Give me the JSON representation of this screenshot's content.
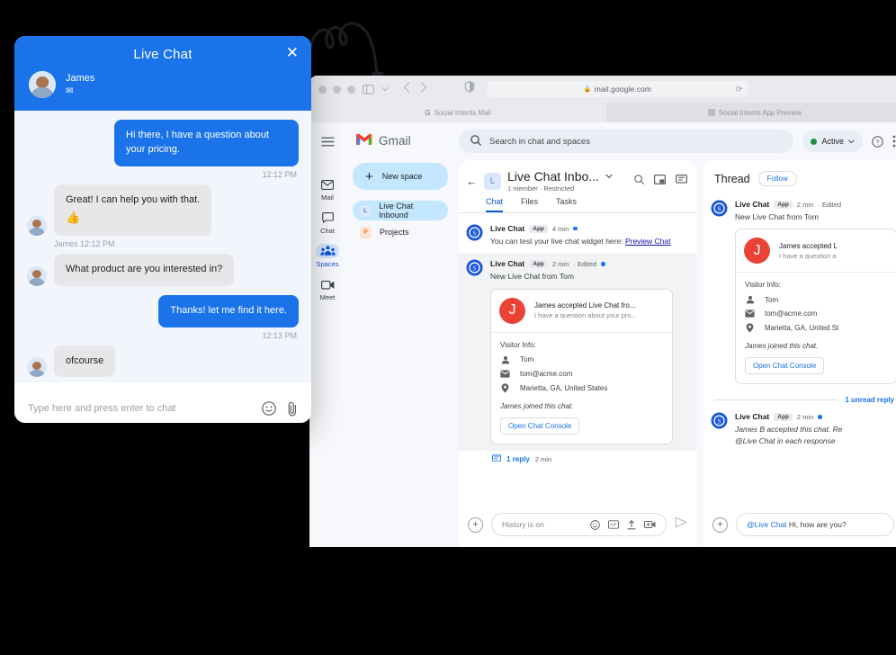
{
  "browser": {
    "address": "mail.google.com",
    "lock_icon": "lock-icon",
    "reload_icon": "reload-icon",
    "tabs": [
      {
        "label": "Social Intents Mail",
        "icon": "google-g-icon",
        "active": false
      },
      {
        "label": "Social Intents App Preview",
        "icon": "app-icon",
        "active": true
      }
    ]
  },
  "gmail": {
    "brand": "Gmail",
    "rail": [
      {
        "label": "Mail",
        "icon": "mail-icon",
        "active": false
      },
      {
        "label": "Chat",
        "icon": "chat-icon",
        "active": false
      },
      {
        "label": "Spaces",
        "icon": "spaces-icon",
        "active": true
      },
      {
        "label": "Meet",
        "icon": "meet-icon",
        "active": false
      }
    ],
    "new_space_label": "New space",
    "spaces": [
      {
        "label": "Live Chat Inbound",
        "badge": "L",
        "active": true
      },
      {
        "label": "Projects",
        "badge": "P",
        "active": false
      }
    ],
    "search_placeholder": "Search in chat and spaces",
    "status_label": "Active",
    "status_color": "#1e8e3e",
    "help_icon": "help-icon",
    "more_icon": "more-vertical-icon"
  },
  "space": {
    "avatar_letter": "L",
    "title": "Live Chat Inbo...",
    "subtitle": "1 member  ·  Restricted",
    "tabs": [
      {
        "label": "Chat",
        "active": true
      },
      {
        "label": "Files",
        "active": false
      },
      {
        "label": "Tasks",
        "active": false
      }
    ],
    "header_icons": [
      "search-icon",
      "pip-icon",
      "thread-icon"
    ],
    "messages": [
      {
        "author": "Live Chat",
        "app_tag": "App",
        "time": "4 min",
        "edited": "",
        "text": "You can test your live chat widget here: ",
        "link": "Preview Chat"
      },
      {
        "author": "Live Chat",
        "app_tag": "App",
        "time": "2 min",
        "edited": "· Edited",
        "text": "New Live Chat from Tom"
      }
    ],
    "card": {
      "avatar_letter": "J",
      "avatar_color": "#ea4335",
      "title": "James accepted Live Chat fro...",
      "subtitle": "I have a question about your pro...",
      "visitor_label": "Visitor Info:",
      "rows": [
        {
          "icon": "person-icon",
          "value": "Tom"
        },
        {
          "icon": "envelope-icon",
          "value": "tom@acme.com"
        },
        {
          "icon": "location-pin-icon",
          "value": "Marietta, GA, United States"
        }
      ],
      "joined_note": "James joined this chat.",
      "button": "Open Chat Console"
    },
    "reply_summary": {
      "icon": "reply-icon",
      "count": "1 reply",
      "time": "2 min"
    },
    "composer": {
      "placeholder": "History is on",
      "icons": [
        "emoji-icon",
        "gif-icon",
        "upload-icon",
        "video-icon"
      ],
      "send_icon": "send-icon",
      "add_icon": "plus-circle-icon"
    }
  },
  "thread": {
    "title": "Thread",
    "follow_label": "Follow",
    "message": {
      "author": "Live Chat",
      "app_tag": "App",
      "time": "2 min",
      "edited": "· Edited",
      "text": "New Live Chat from Tom"
    },
    "card": {
      "avatar_letter": "J",
      "title": "James accepted L",
      "subtitle": "I have a question a",
      "visitor_label": "Visitor Info:",
      "rows": [
        {
          "icon": "person-icon",
          "value": "Tom"
        },
        {
          "icon": "envelope-icon",
          "value": "tom@acme.com"
        },
        {
          "icon": "location-pin-icon",
          "value": "Marietta, GA, United St"
        }
      ],
      "joined_note": "James joined this chat.",
      "button": "Open Chat Console"
    },
    "unread_label": "1 unread reply",
    "reply": {
      "author": "Live Chat",
      "app_tag": "App",
      "time": "2 min",
      "line1": "James B accepted this chat.  Re",
      "line2": "@Live Chat in each response"
    },
    "composer": {
      "mention": "@Live Chat",
      "text": " Hi, how are you?",
      "add_icon": "plus-circle-icon"
    }
  },
  "widget": {
    "title": "Live Chat",
    "close_icon": "close-icon",
    "agent_name": "James",
    "agent_icon": "envelope-icon",
    "accent_color": "#1a73e8",
    "messages": [
      {
        "side": "out",
        "text": "Hi there, I have a question about your pricing."
      },
      {
        "stamp": "12:12 PM",
        "align": "right"
      },
      {
        "side": "in",
        "text": "Great! I can help you with that.",
        "emoji": "👍"
      },
      {
        "stamp": "James 12:12 PM",
        "align": "left"
      },
      {
        "side": "in",
        "text": "What product are you interested in?"
      },
      {
        "side": "out",
        "text": "Thanks! let me find it here."
      },
      {
        "stamp": "12:13 PM",
        "align": "right"
      },
      {
        "side": "in",
        "text": "ofcourse"
      }
    ],
    "input_placeholder": "Type here and press enter to chat",
    "input_icons": [
      "emoji-icon",
      "attachment-icon"
    ]
  }
}
